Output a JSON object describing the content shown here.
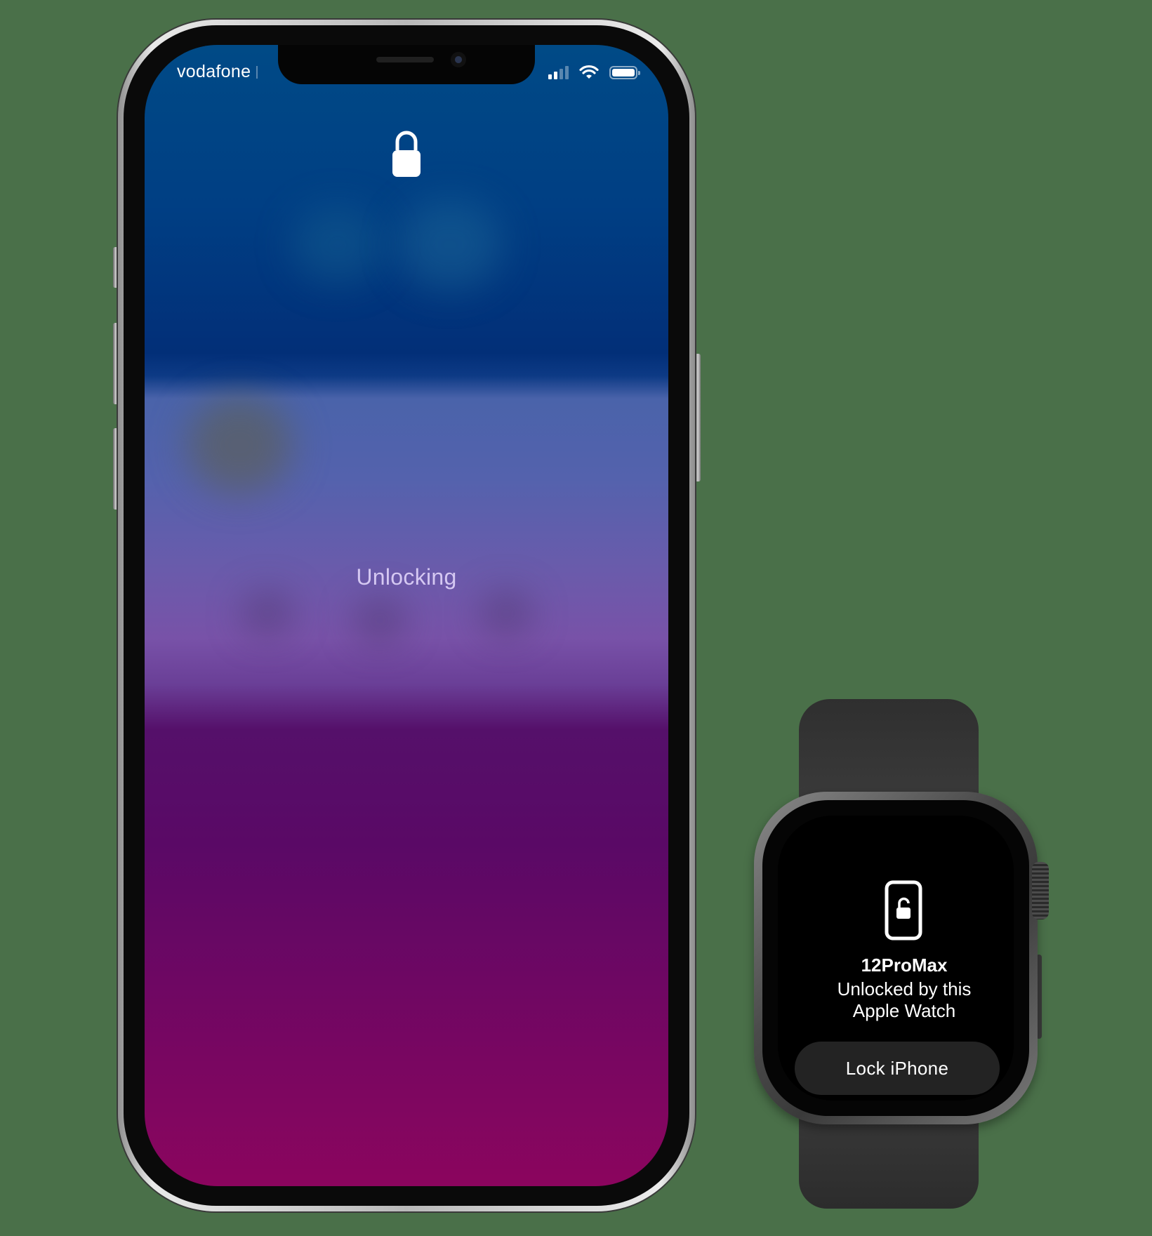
{
  "phone": {
    "status_bar": {
      "carrier": "vodafone",
      "signal_bars_active": 2,
      "signal_bars_total": 4,
      "battery_level": 1.0,
      "icons": [
        "signal-icon",
        "wifi-icon",
        "battery-icon"
      ]
    },
    "lock_icon": "lock-icon",
    "status_message": "Unlocking"
  },
  "watch": {
    "icon": "phone-unlocked-icon",
    "device_name": "12ProMax",
    "message_line1": "Unlocked by this",
    "message_line2": "Apple Watch",
    "lock_button_label": "Lock iPhone"
  },
  "colors": {
    "background": "#4a7049",
    "screen_top": "#004a86",
    "screen_middle": "#7852a8",
    "screen_bottom": "#8b055e",
    "unlocking_text": "#d5c8f2",
    "watch_button": "#232323"
  }
}
